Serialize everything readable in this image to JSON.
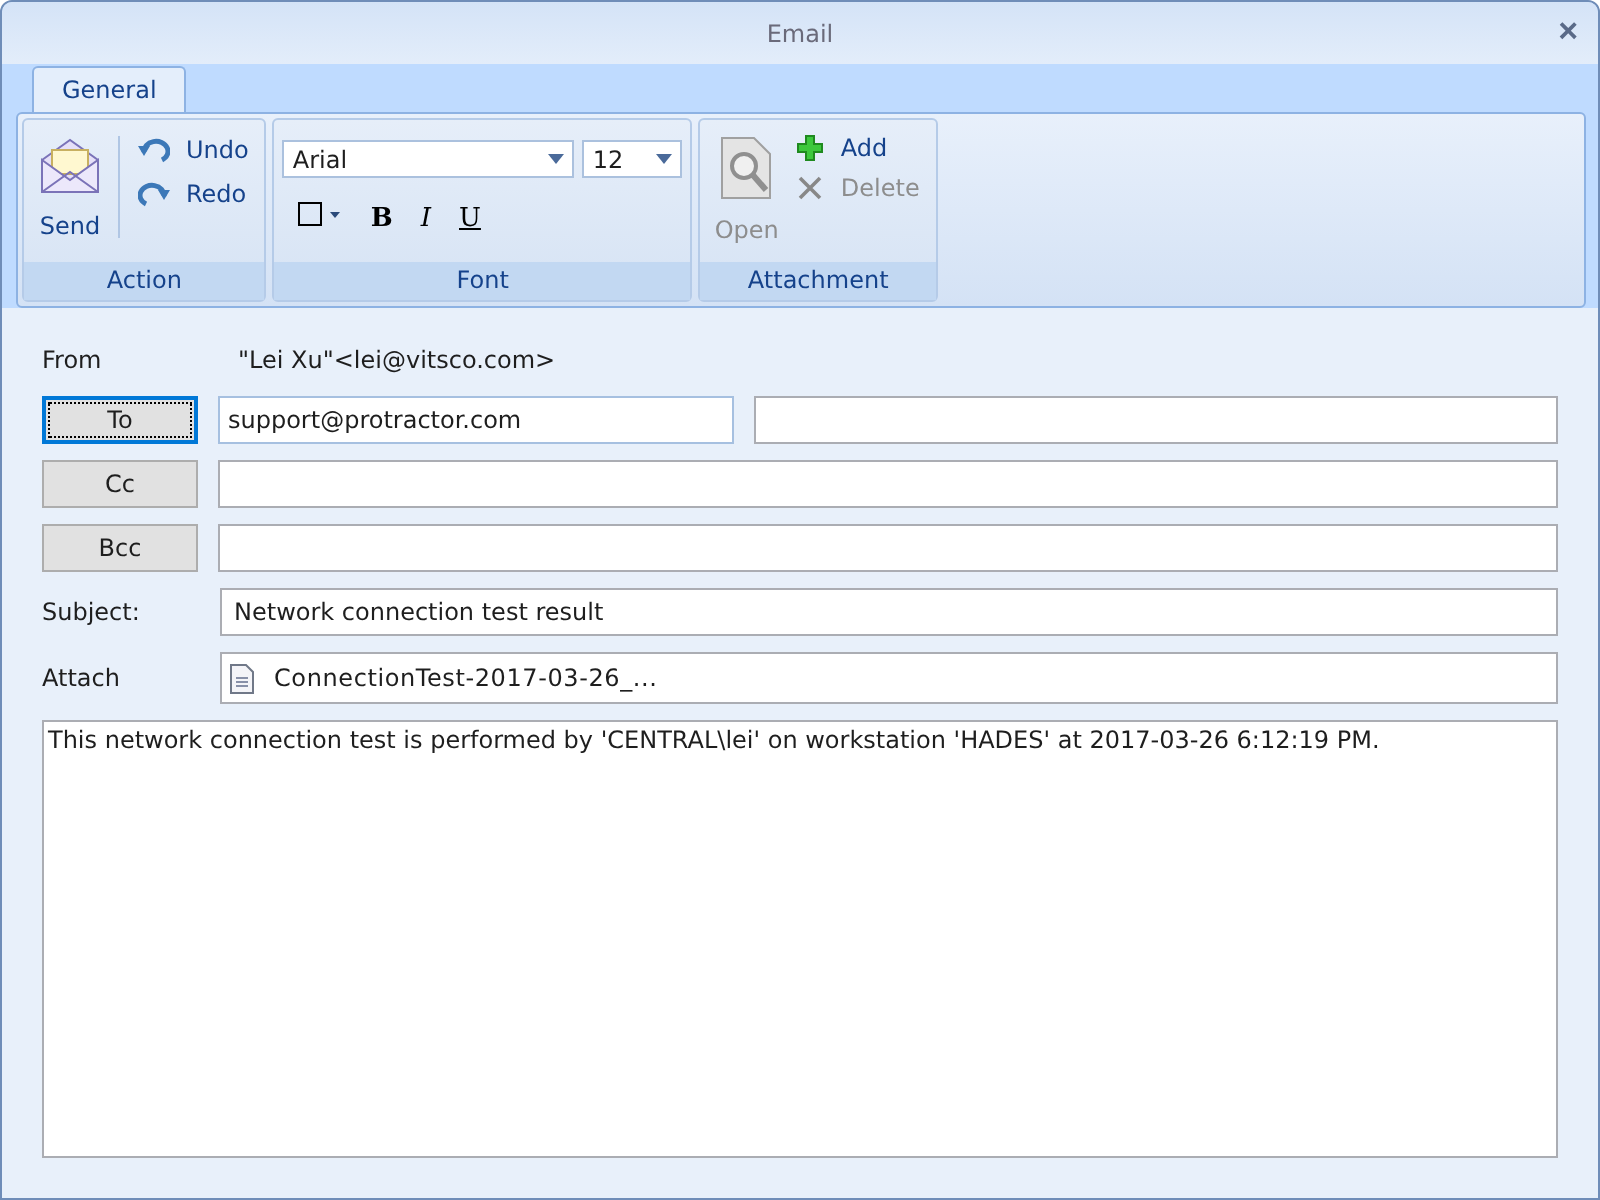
{
  "window": {
    "title": "Email",
    "close": "×"
  },
  "tabs": [
    {
      "label": "General",
      "selected": true
    }
  ],
  "ribbon": {
    "action": {
      "label": "Action",
      "send": "Send",
      "undo": "Undo",
      "redo": "Redo"
    },
    "font": {
      "label": "Font",
      "family": "Arial",
      "size": "12",
      "bold": "B",
      "italic": "I",
      "underline": "U"
    },
    "attachment": {
      "label": "Attachment",
      "open": {
        "label": "Open",
        "disabled": true
      },
      "add": {
        "label": "Add",
        "disabled": false
      },
      "delete": {
        "label": "Delete",
        "disabled": true
      }
    }
  },
  "form": {
    "from_label": "From",
    "from_value": "\"Lei Xu\"<lei@vitsco.com>",
    "to_button": {
      "label": "To",
      "focused": true
    },
    "to_value": "support@protractor.com",
    "cc_button": {
      "label": "Cc",
      "focused": false
    },
    "bcc_button": {
      "label": "Bcc",
      "focused": false
    },
    "subject_label": "Subject:",
    "subject_value": "Network connection test result",
    "attach_label": "Attach",
    "attachment_name": "ConnectionTest-2017-03-26_...",
    "body": "This network connection test is performed by 'CENTRAL\\lei' on workstation 'HADES' at 2017-03-26 6:12:19 PM."
  }
}
